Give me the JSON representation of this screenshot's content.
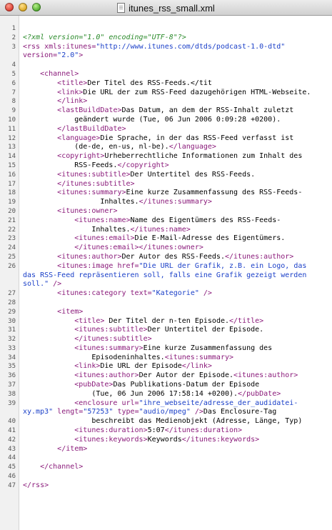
{
  "window": {
    "title": "itunes_rss_small.xml"
  },
  "colors": {
    "tag": "#8a1a7a",
    "value": "#1a3fc8",
    "processing_instruction": "#2a8a2a",
    "text": "#000000"
  },
  "icons": [
    "close-icon",
    "minimize-icon",
    "zoom-icon",
    "document-icon"
  ],
  "lines": [
    {
      "n": "1",
      "segs": []
    },
    {
      "n": "2",
      "segs": [
        {
          "c": "pi",
          "t": "<?xml version=\"1.0\" encoding=\"UTF-8\"?>"
        }
      ]
    },
    {
      "n": "3",
      "segs": [
        {
          "c": "tag",
          "t": "<rss "
        },
        {
          "c": "attr",
          "t": "xmls:itunes="
        },
        {
          "c": "val",
          "t": "\"http://www.itunes.com/dtds/podcast-1.0-dtd\""
        }
      ]
    },
    {
      "n": "",
      "segs": [
        {
          "c": "attr",
          "t": "version="
        },
        {
          "c": "val",
          "t": "\"2.0\""
        },
        {
          "c": "tag",
          "t": ">"
        }
      ]
    },
    {
      "n": "4",
      "segs": []
    },
    {
      "n": "5",
      "segs": [
        {
          "c": "text",
          "t": "    "
        },
        {
          "c": "tag",
          "t": "<channel>"
        }
      ]
    },
    {
      "n": "6",
      "segs": [
        {
          "c": "text",
          "t": "        "
        },
        {
          "c": "tag",
          "t": "<title>"
        },
        {
          "c": "text",
          "t": "Der Titel des RSS-Feeds.</tit"
        }
      ]
    },
    {
      "n": "7",
      "segs": [
        {
          "c": "text",
          "t": "        "
        },
        {
          "c": "tag",
          "t": "<link>"
        },
        {
          "c": "text",
          "t": "Die URL der zum RSS-Feed dazugehörigen HTML-Webseite."
        }
      ]
    },
    {
      "n": "8",
      "segs": [
        {
          "c": "text",
          "t": "        "
        },
        {
          "c": "tag",
          "t": "</link>"
        }
      ]
    },
    {
      "n": "9",
      "segs": [
        {
          "c": "text",
          "t": "        "
        },
        {
          "c": "tag",
          "t": "<lastBuildDate>"
        },
        {
          "c": "text",
          "t": "Das Datum, an dem der RSS-Inhalt zuletzt"
        }
      ]
    },
    {
      "n": "10",
      "segs": [
        {
          "c": "text",
          "t": "            geändert wurde (Tue, 06 Jun 2006 0:09:28 +0200)."
        }
      ]
    },
    {
      "n": "11",
      "segs": [
        {
          "c": "text",
          "t": "        "
        },
        {
          "c": "tag",
          "t": "</lastBuildDate>"
        }
      ]
    },
    {
      "n": "12",
      "segs": [
        {
          "c": "text",
          "t": "        "
        },
        {
          "c": "tag",
          "t": "<language>"
        },
        {
          "c": "text",
          "t": "Die Sprache, in der das RSS-Feed verfasst ist"
        }
      ]
    },
    {
      "n": "13",
      "segs": [
        {
          "c": "text",
          "t": "            (de-de, en-us, nl-be)."
        },
        {
          "c": "tag",
          "t": "</language>"
        }
      ]
    },
    {
      "n": "14",
      "segs": [
        {
          "c": "text",
          "t": "        "
        },
        {
          "c": "tag",
          "t": "<copyright>"
        },
        {
          "c": "text",
          "t": "Urheberrechtliche Informationen zum Inhalt des"
        }
      ]
    },
    {
      "n": "15",
      "segs": [
        {
          "c": "text",
          "t": "            RSS-Feeds."
        },
        {
          "c": "tag",
          "t": "</copyright>"
        }
      ]
    },
    {
      "n": "16",
      "segs": [
        {
          "c": "text",
          "t": "        "
        },
        {
          "c": "tag",
          "t": "<itunes:subtitle>"
        },
        {
          "c": "text",
          "t": "Der Untertitel des RSS-Feeds."
        }
      ]
    },
    {
      "n": "17",
      "segs": [
        {
          "c": "text",
          "t": "        "
        },
        {
          "c": "tag",
          "t": "</itunes:subtitle>"
        }
      ]
    },
    {
      "n": "18",
      "segs": [
        {
          "c": "text",
          "t": "        "
        },
        {
          "c": "tag",
          "t": "<itunes:summary>"
        },
        {
          "c": "text",
          "t": "Eine kurze Zusammenfassung des RSS-Feeds-"
        }
      ]
    },
    {
      "n": "19",
      "segs": [
        {
          "c": "text",
          "t": "                  Inhaltes."
        },
        {
          "c": "tag",
          "t": "</itunes:summary>"
        }
      ]
    },
    {
      "n": "20",
      "segs": [
        {
          "c": "text",
          "t": "        "
        },
        {
          "c": "tag",
          "t": "<itunes:owner>"
        }
      ]
    },
    {
      "n": "21",
      "segs": [
        {
          "c": "text",
          "t": "            "
        },
        {
          "c": "tag",
          "t": "<itunes:name>"
        },
        {
          "c": "text",
          "t": "Name des Eigentümers des RSS-Feeds-"
        }
      ]
    },
    {
      "n": "22",
      "segs": [
        {
          "c": "text",
          "t": "                Inhaltes."
        },
        {
          "c": "tag",
          "t": "</itunes:name>"
        }
      ]
    },
    {
      "n": "23",
      "segs": [
        {
          "c": "text",
          "t": "            "
        },
        {
          "c": "tag",
          "t": "<itunes:email>"
        },
        {
          "c": "text",
          "t": "Die E-Mail-Adresse des Eigentümers."
        }
      ]
    },
    {
      "n": "24",
      "segs": [
        {
          "c": "text",
          "t": "            "
        },
        {
          "c": "tag",
          "t": "</itunes:email></itunes:owner>"
        }
      ]
    },
    {
      "n": "25",
      "segs": [
        {
          "c": "text",
          "t": "        "
        },
        {
          "c": "tag",
          "t": "<itunes:author>"
        },
        {
          "c": "text",
          "t": "Der Autor des RSS-Feeds."
        },
        {
          "c": "tag",
          "t": "</itunes:author>"
        }
      ]
    },
    {
      "n": "26",
      "segs": [
        {
          "c": "text",
          "t": "        "
        },
        {
          "c": "tag",
          "t": "<itunes:image "
        },
        {
          "c": "attr",
          "t": "href="
        },
        {
          "c": "val",
          "t": "\"Die URL der Grafik, z.B. ein Logo, das"
        }
      ]
    },
    {
      "n": "",
      "segs": [
        {
          "c": "val",
          "t": "das RSS-Feed repräsentieren soll, falls eine Grafik gezeigt werden"
        }
      ]
    },
    {
      "n": "",
      "segs": [
        {
          "c": "val",
          "t": "soll.\""
        },
        {
          "c": "tag",
          "t": " />"
        }
      ]
    },
    {
      "n": "27",
      "segs": [
        {
          "c": "text",
          "t": "        "
        },
        {
          "c": "tag",
          "t": "<itunes:category "
        },
        {
          "c": "attr",
          "t": "text="
        },
        {
          "c": "val",
          "t": "\"Kategorie\""
        },
        {
          "c": "tag",
          "t": " />"
        }
      ]
    },
    {
      "n": "28",
      "segs": []
    },
    {
      "n": "29",
      "segs": [
        {
          "c": "text",
          "t": "        "
        },
        {
          "c": "tag",
          "t": "<item>"
        }
      ]
    },
    {
      "n": "30",
      "segs": [
        {
          "c": "text",
          "t": "            "
        },
        {
          "c": "tag",
          "t": "<title>"
        },
        {
          "c": "text",
          "t": " Der Titel der n-ten Episode."
        },
        {
          "c": "tag",
          "t": "</title>"
        }
      ]
    },
    {
      "n": "31",
      "segs": [
        {
          "c": "text",
          "t": "            "
        },
        {
          "c": "tag",
          "t": "<itunes:subtitle>"
        },
        {
          "c": "text",
          "t": "Der Untertitel der Episode."
        }
      ]
    },
    {
      "n": "32",
      "segs": [
        {
          "c": "text",
          "t": "            "
        },
        {
          "c": "tag",
          "t": "</itunes:subtitle>"
        }
      ]
    },
    {
      "n": "33",
      "segs": [
        {
          "c": "text",
          "t": "            "
        },
        {
          "c": "tag",
          "t": "<itunes:summary>"
        },
        {
          "c": "text",
          "t": "Eine kurze Zusammenfassung des"
        }
      ]
    },
    {
      "n": "34",
      "segs": [
        {
          "c": "text",
          "t": "                Episodeninhaltes."
        },
        {
          "c": "tag",
          "t": "<itunes:summary>"
        }
      ]
    },
    {
      "n": "35",
      "segs": [
        {
          "c": "text",
          "t": "            "
        },
        {
          "c": "tag",
          "t": "<link>"
        },
        {
          "c": "text",
          "t": "Die URL der Episode"
        },
        {
          "c": "tag",
          "t": "</link>"
        }
      ]
    },
    {
      "n": "36",
      "segs": [
        {
          "c": "text",
          "t": "            "
        },
        {
          "c": "tag",
          "t": "<itunes:author>"
        },
        {
          "c": "text",
          "t": "Der Autor der Episode."
        },
        {
          "c": "tag",
          "t": "<itunes:author>"
        }
      ]
    },
    {
      "n": "37",
      "segs": [
        {
          "c": "text",
          "t": "            "
        },
        {
          "c": "tag",
          "t": "<pubDate>"
        },
        {
          "c": "text",
          "t": "Das Publikations-Datum der Episode"
        }
      ]
    },
    {
      "n": "38",
      "segs": [
        {
          "c": "text",
          "t": "                (Tue, 06 Jun 2006 17:58:14 +0200)."
        },
        {
          "c": "tag",
          "t": "</pubDate>"
        }
      ]
    },
    {
      "n": "39",
      "segs": [
        {
          "c": "text",
          "t": "            "
        },
        {
          "c": "tag",
          "t": "<enclosure "
        },
        {
          "c": "attr",
          "t": "url="
        },
        {
          "c": "val",
          "t": "\"ihre_webseite/adresse_der_audidatei-"
        }
      ]
    },
    {
      "n": "",
      "segs": [
        {
          "c": "val",
          "t": "xy.mp3\""
        },
        {
          "c": "attr",
          "t": " lengt="
        },
        {
          "c": "val",
          "t": "\"57253\""
        },
        {
          "c": "attr",
          "t": " type="
        },
        {
          "c": "val",
          "t": "\"audio/mpeg\""
        },
        {
          "c": "tag",
          "t": " />"
        },
        {
          "c": "text",
          "t": "Das Enclosure-Tag"
        }
      ]
    },
    {
      "n": "40",
      "segs": [
        {
          "c": "text",
          "t": "                beschreibt das Medienobjekt (Adresse, Länge, Typ)"
        }
      ]
    },
    {
      "n": "41",
      "segs": [
        {
          "c": "text",
          "t": "            "
        },
        {
          "c": "tag",
          "t": "<itunes:duration>"
        },
        {
          "c": "text",
          "t": "5:07"
        },
        {
          "c": "tag",
          "t": "</itunes:duration>"
        }
      ]
    },
    {
      "n": "42",
      "segs": [
        {
          "c": "text",
          "t": "            "
        },
        {
          "c": "tag",
          "t": "<itunes:keywords>"
        },
        {
          "c": "text",
          "t": "Keywords"
        },
        {
          "c": "tag",
          "t": "</itunes:keywords>"
        }
      ]
    },
    {
      "n": "43",
      "segs": [
        {
          "c": "text",
          "t": "        "
        },
        {
          "c": "tag",
          "t": "</item>"
        }
      ]
    },
    {
      "n": "44",
      "segs": []
    },
    {
      "n": "45",
      "segs": [
        {
          "c": "text",
          "t": "    "
        },
        {
          "c": "tag",
          "t": "</channel>"
        }
      ]
    },
    {
      "n": "46",
      "segs": []
    },
    {
      "n": "47",
      "segs": [
        {
          "c": "tag",
          "t": "</rss>"
        }
      ]
    }
  ]
}
